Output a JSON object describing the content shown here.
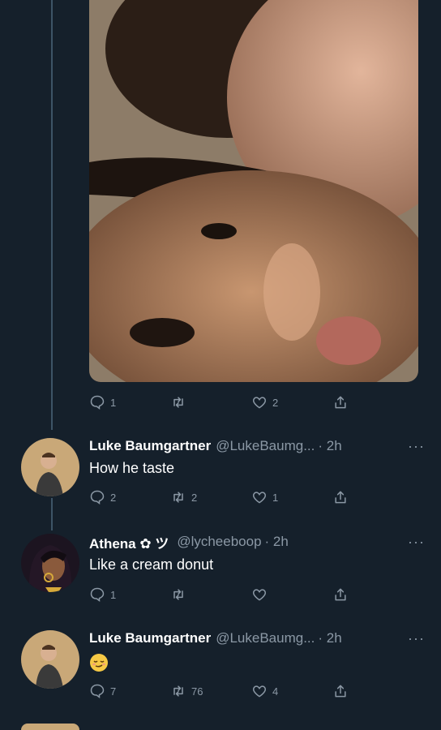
{
  "media_post": {
    "reply_count": "1",
    "retweet_count": "",
    "like_count": "2"
  },
  "tweets": [
    {
      "name": "Luke Baumgartner",
      "handle": "@LukeBaumg...",
      "time": "· 2h",
      "text": "How he taste",
      "reply_count": "2",
      "retweet_count": "2",
      "like_count": "1"
    },
    {
      "name": "Athena ✿ ツ",
      "handle": "@lycheeboop",
      "time": "· 2h",
      "text": "Like a cream donut",
      "reply_count": "1",
      "retweet_count": "",
      "like_count": ""
    },
    {
      "name": "Luke Baumgartner",
      "handle": "@LukeBaumg...",
      "time": "· 2h",
      "text": "",
      "reply_count": "7",
      "retweet_count": "76",
      "like_count": "4"
    }
  ],
  "more_label": "···",
  "colors": {
    "background": "#15202b",
    "muted": "#8b98a5",
    "thread_line": "#3d5466"
  },
  "icons": [
    "reply-icon",
    "retweet-icon",
    "like-icon",
    "share-icon",
    "more-icon",
    "relieved-face-emoji"
  ]
}
